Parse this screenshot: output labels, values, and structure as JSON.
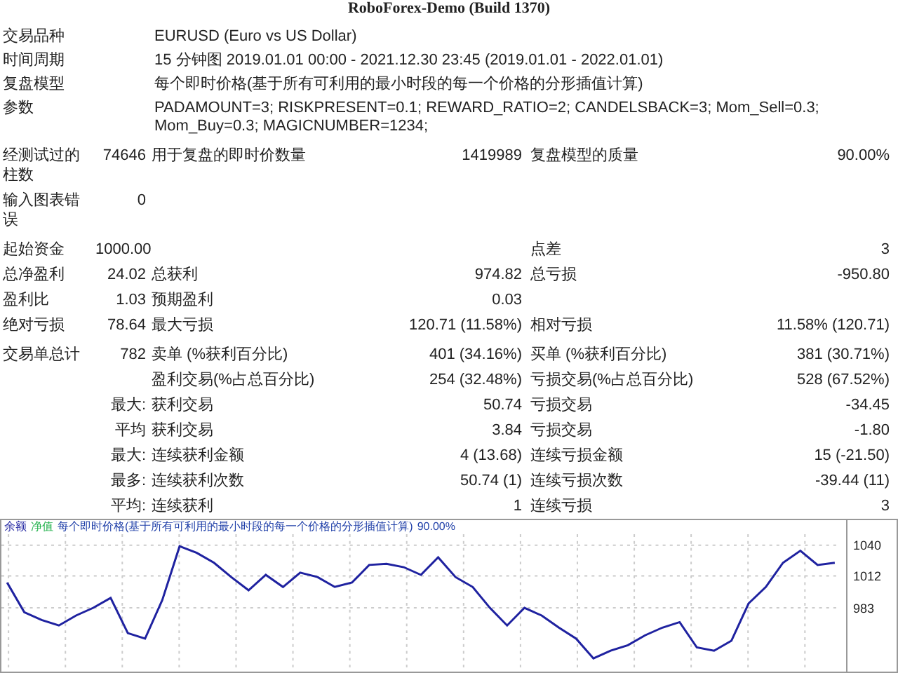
{
  "title": "RoboForex-Demo (Build 1370)",
  "info": [
    {
      "label": "交易品种",
      "value": "EURUSD (Euro vs US Dollar)"
    },
    {
      "label": "时间周期",
      "value": "15 分钟图 2019.01.01 00:00 - 2021.12.30 23:45 (2019.01.01 - 2022.01.01)"
    },
    {
      "label": "复盘模型",
      "value": "每个即时价格(基于所有可利用的最小时段的每一个价格的分形插值计算)"
    },
    {
      "label": "参数",
      "value": "PADAMOUNT=3; RISKPRESENT=0.1; REWARD_RATIO=2; CANDELSBACK=3; Mom_Sell=0.3; Mom_Buy=0.3; MAGICNUMBER=1234;"
    }
  ],
  "stat_groups": [
    [
      {
        "label": "经测试过的柱数",
        "value": "74646",
        "label_2": "用于复盘的即时价数量",
        "value_2": "1419989",
        "label_3": "复盘模型的质量",
        "value_3": "90.00%"
      },
      {
        "label": "输入图表错误",
        "value": "0"
      }
    ],
    [
      {
        "label": "起始资金",
        "value": "1000.00",
        "label_3": "点差",
        "value_3": "3"
      },
      {
        "label": "总净盈利",
        "value": "24.02",
        "label_2": "总获利",
        "value_2": "974.82",
        "label_3": "总亏损",
        "value_3": "-950.80"
      },
      {
        "label": "盈利比",
        "value": "1.03",
        "label_2": "预期盈利",
        "value_2": "0.03"
      },
      {
        "label": "绝对亏损",
        "value": "78.64",
        "label_2": "最大亏损",
        "value_2": "120.71 (11.58%)",
        "label_3": "相对亏损",
        "value_3": "11.58% (120.71)"
      }
    ],
    [
      {
        "label": "交易单总计",
        "value": "782",
        "label_2": "卖单 (%获利百分比)",
        "value_2": "401 (34.16%)",
        "label_3": "买单 (%获利百分比)",
        "value_3": "381 (30.71%)"
      },
      {
        "label_2": "盈利交易(%占总百分比)",
        "value_2": "254 (32.48%)",
        "label_3": "亏损交易(%占总百分比)",
        "value_3": "528 (67.52%)"
      },
      {
        "prefix": "最大:",
        "label_2": "获利交易",
        "value_2": "50.74",
        "label_3": "亏损交易",
        "value_3": "-34.45"
      },
      {
        "prefix": "平均",
        "label_2": "获利交易",
        "value_2": "3.84",
        "label_3": "亏损交易",
        "value_3": "-1.80"
      },
      {
        "prefix": "最大:",
        "label_2": "连续获利金额",
        "value_2": "4 (13.68)",
        "label_3": "连续亏损金额",
        "value_3": "15 (-21.50)"
      },
      {
        "prefix": "最多:",
        "label_2": "连续获利次数",
        "value_2": "50.74 (1)",
        "label_3": "连续亏损次数",
        "value_3": "-39.44 (11)"
      },
      {
        "prefix": "平均:",
        "label_2": "连续获利",
        "value_2": "1",
        "label_3": "连续亏损",
        "value_3": "3"
      }
    ]
  ],
  "chart": {
    "legend": [
      {
        "text": "净值",
        "color": "#22b14c"
      },
      {
        "text": "每个即时价格(基于所有可利用的最小时段的每一个价格的分形插值计算)",
        "color": "#1f3fa8"
      },
      {
        "text": "90.00%",
        "color": "#1f3fa8"
      }
    ],
    "chart_data": {
      "type": "line",
      "grid": true,
      "yticks": [
        983,
        1012,
        1040
      ],
      "ylim": [
        925,
        1050
      ],
      "series": [
        {
          "name": "余额",
          "color": "#1f22a0",
          "values": [
            1006,
            979,
            972,
            967,
            976,
            983,
            992,
            960,
            955,
            990,
            1039,
            1033,
            1024,
            1011,
            999,
            1013,
            1002,
            1015,
            1011,
            1002,
            1006,
            1022,
            1023,
            1020,
            1013,
            1029,
            1011,
            1002,
            983,
            967,
            983,
            976,
            965,
            955,
            937,
            944,
            949,
            958,
            965,
            970,
            947,
            944,
            953,
            987,
            1002,
            1024,
            1035,
            1022,
            1024
          ]
        }
      ]
    }
  }
}
